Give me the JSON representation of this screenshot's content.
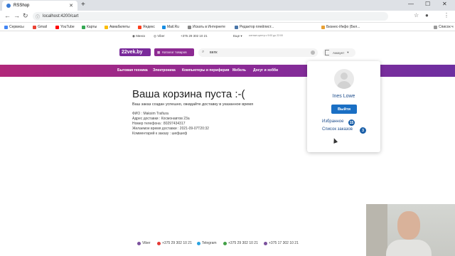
{
  "browser": {
    "tab_title": "RSShop",
    "new_tab_symbol": "+",
    "url": "localhost:4200/cart",
    "minimize": "—",
    "maximize": "☐",
    "close": "✕"
  },
  "bookmarks": [
    {
      "label": "Сервисы",
      "color": "#4285f4"
    },
    {
      "label": "Gmail",
      "color": "#ea4335"
    },
    {
      "label": "YouTube",
      "color": "#ff0000"
    },
    {
      "label": "Карты",
      "color": "#34a853"
    },
    {
      "label": "Авиабилеты",
      "color": "#fbbc05"
    },
    {
      "label": "Яндекс",
      "color": "#fc3f1d"
    },
    {
      "label": "Mail.Ru",
      "color": "#168de2"
    },
    {
      "label": "Искать в Интернете",
      "color": "#888888"
    },
    {
      "label": "Редактор плейлист...",
      "color": "#4a76a8"
    },
    {
      "label": "Бизнес-Инфо (Бел...",
      "color": "#e8a033"
    },
    {
      "label": "Список ч",
      "color": "#999999"
    }
  ],
  "topinfo": {
    "city": "Минск",
    "viber": "Viber",
    "phone": "+375 29 302 10 21",
    "more": "Еще",
    "hours": "контакт-центр с 9:00 до 22:00"
  },
  "header": {
    "logo": "22vek.by",
    "catalog": "Каталог товаров",
    "search_value": "вилк",
    "account": "Аккаунт"
  },
  "nav": [
    "Бытовая техника",
    "Электроника",
    "Компьютеры и периферия",
    "Мебель",
    "Досуг и хобби"
  ],
  "cart": {
    "title": "Ваша корзина пуста :-(",
    "subtitle": "Ваш заказ создан успешно, ожидайте доставку в указанное время",
    "details": [
      "ФИО : Maksim Trafiura",
      "Адрес доставки : Космонавтов 23а",
      "Номер телефона : 80297434317",
      "Желаемое время доставки : 2021-09-07T20:32",
      "Комментарий к заказу : шефшеф"
    ]
  },
  "dropdown": {
    "user_name": "Ines Lowe",
    "logout": "Выйти",
    "favorites": "Избранное",
    "favorites_count": "15",
    "orders": "Список заказов",
    "orders_count": "3"
  },
  "footer": [
    {
      "label": "Viber",
      "color": "#7b519d"
    },
    {
      "label": "+375 29 302 10 21",
      "color": "#e53935"
    },
    {
      "label": "Telegram",
      "color": "#2aa3e0"
    },
    {
      "label": "+375 29 302 10 21",
      "color": "#43a047"
    },
    {
      "label": "+375 17 302 10 21",
      "color": "#7b519d"
    }
  ]
}
